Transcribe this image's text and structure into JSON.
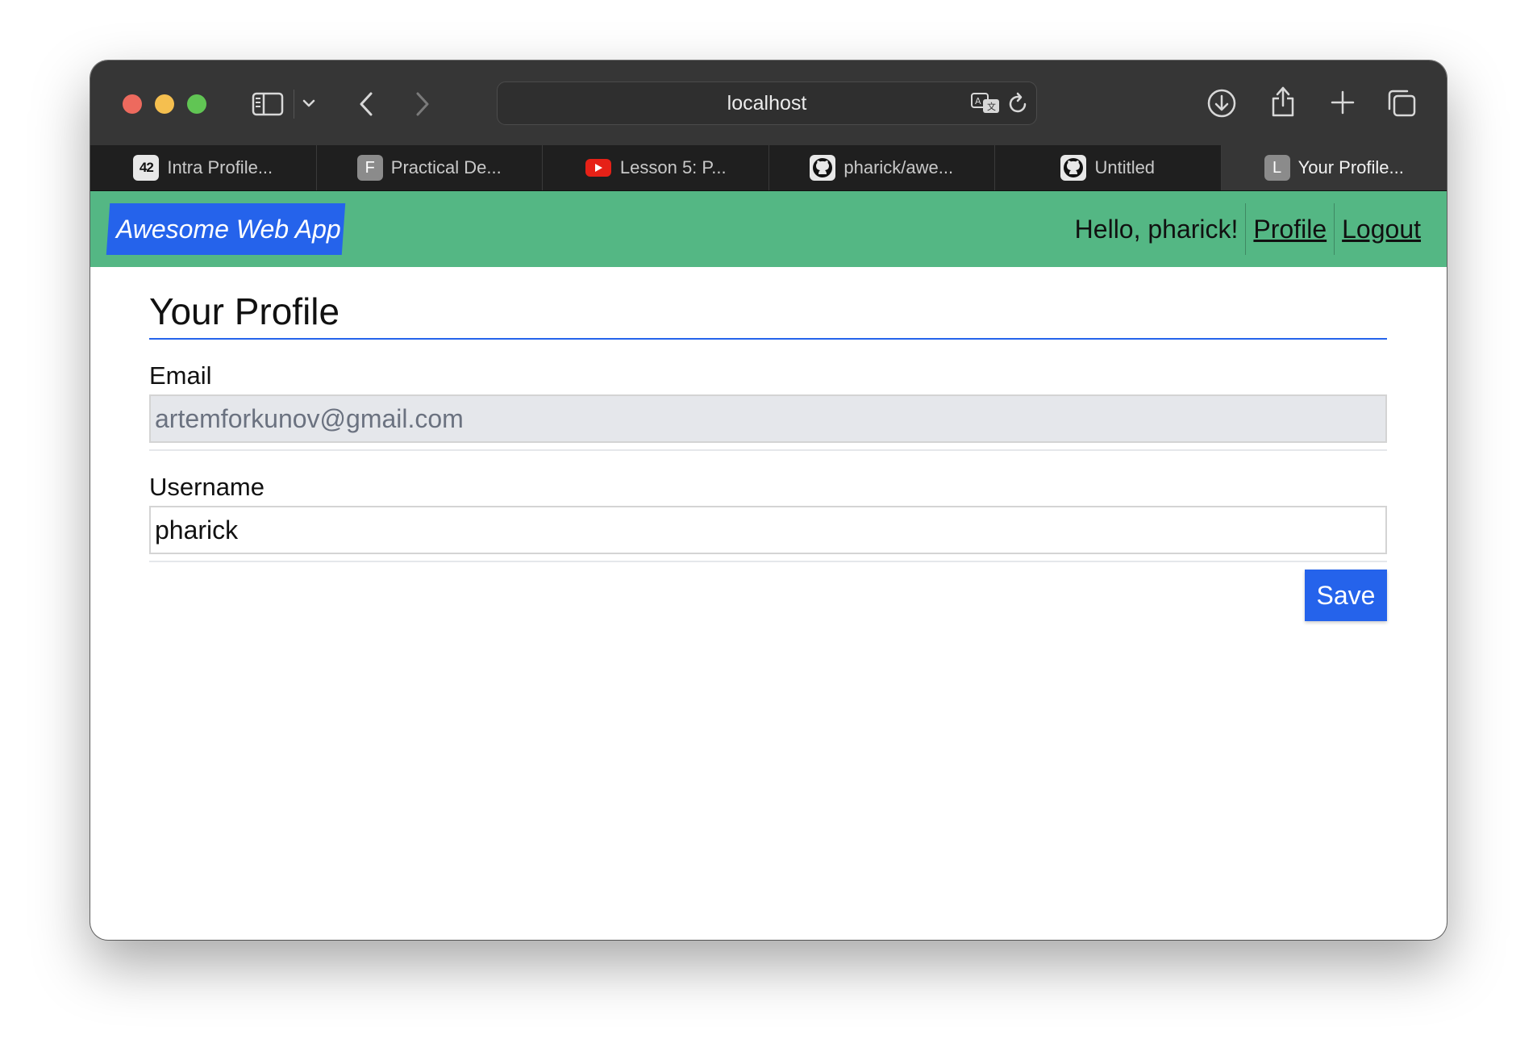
{
  "browser": {
    "url": "localhost",
    "icons": {
      "sidebar": "sidebar-icon",
      "dropdown": "chevron-down-icon",
      "back": "chevron-left-icon",
      "forward": "chevron-right-icon",
      "translate": "translate-icon",
      "reload": "reload-icon",
      "download": "download-icon",
      "share": "share-icon",
      "new_tab": "plus-icon",
      "tab_overview": "tab-overview-icon"
    },
    "tabs": [
      {
        "label": "Intra Profile...",
        "favicon": "42",
        "active": false
      },
      {
        "label": "Practical De...",
        "favicon": "F",
        "active": false
      },
      {
        "label": "Lesson 5: P...",
        "favicon": "youtube",
        "active": false
      },
      {
        "label": "pharick/awe...",
        "favicon": "github",
        "active": false
      },
      {
        "label": "Untitled",
        "favicon": "github",
        "active": false
      },
      {
        "label": "Your Profile...",
        "favicon": "L",
        "active": true
      }
    ]
  },
  "app": {
    "brand": "Awesome Web App",
    "greeting": "Hello, pharick!",
    "nav_links": {
      "profile": "Profile",
      "logout": "Logout"
    },
    "colors": {
      "navbar": "#54b784",
      "brand_bg": "#2563eb",
      "accent": "#2563eb"
    }
  },
  "page": {
    "title": "Your Profile",
    "form": {
      "email_label": "Email",
      "email_value": "artemforkunov@gmail.com",
      "username_label": "Username",
      "username_value": "pharick",
      "save_label": "Save"
    }
  }
}
